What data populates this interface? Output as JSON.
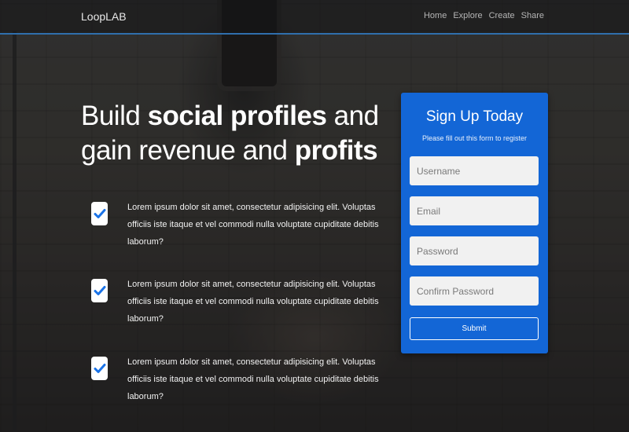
{
  "navbar": {
    "brand": "LoopLAB",
    "links": [
      "Home",
      "Explore",
      "Create",
      "Share"
    ],
    "accent_color": "#2f6fad"
  },
  "hero": {
    "part1": "Build ",
    "bold1": "social profiles",
    "part2": " and gain revenue and ",
    "bold2": "profits"
  },
  "features": [
    {
      "icon": "checkbox-checked-icon",
      "text": "Lorem ipsum dolor sit amet, consectetur adipisicing elit. Voluptas officiis iste itaque et vel commodi nulla voluptate cupiditate debitis laborum?"
    },
    {
      "icon": "checkbox-checked-icon",
      "text": "Lorem ipsum dolor sit amet, consectetur adipisicing elit. Voluptas officiis iste itaque et vel commodi nulla voluptate cupiditate debitis laborum?"
    },
    {
      "icon": "checkbox-checked-icon",
      "text": "Lorem ipsum dolor sit amet, consectetur adipisicing elit. Voluptas officiis iste itaque et vel commodi nulla voluptate cupiditate debitis laborum?"
    }
  ],
  "signup": {
    "title": "Sign Up Today",
    "subtitle": "Please fill out this form to register",
    "fields": {
      "username": {
        "placeholder": "Username",
        "value": ""
      },
      "email": {
        "placeholder": "Email",
        "value": ""
      },
      "password": {
        "placeholder": "Password",
        "value": ""
      },
      "confirm_password": {
        "placeholder": "Confirm Password",
        "value": ""
      }
    },
    "submit_label": "Submit",
    "card_color": "#1366d6"
  }
}
